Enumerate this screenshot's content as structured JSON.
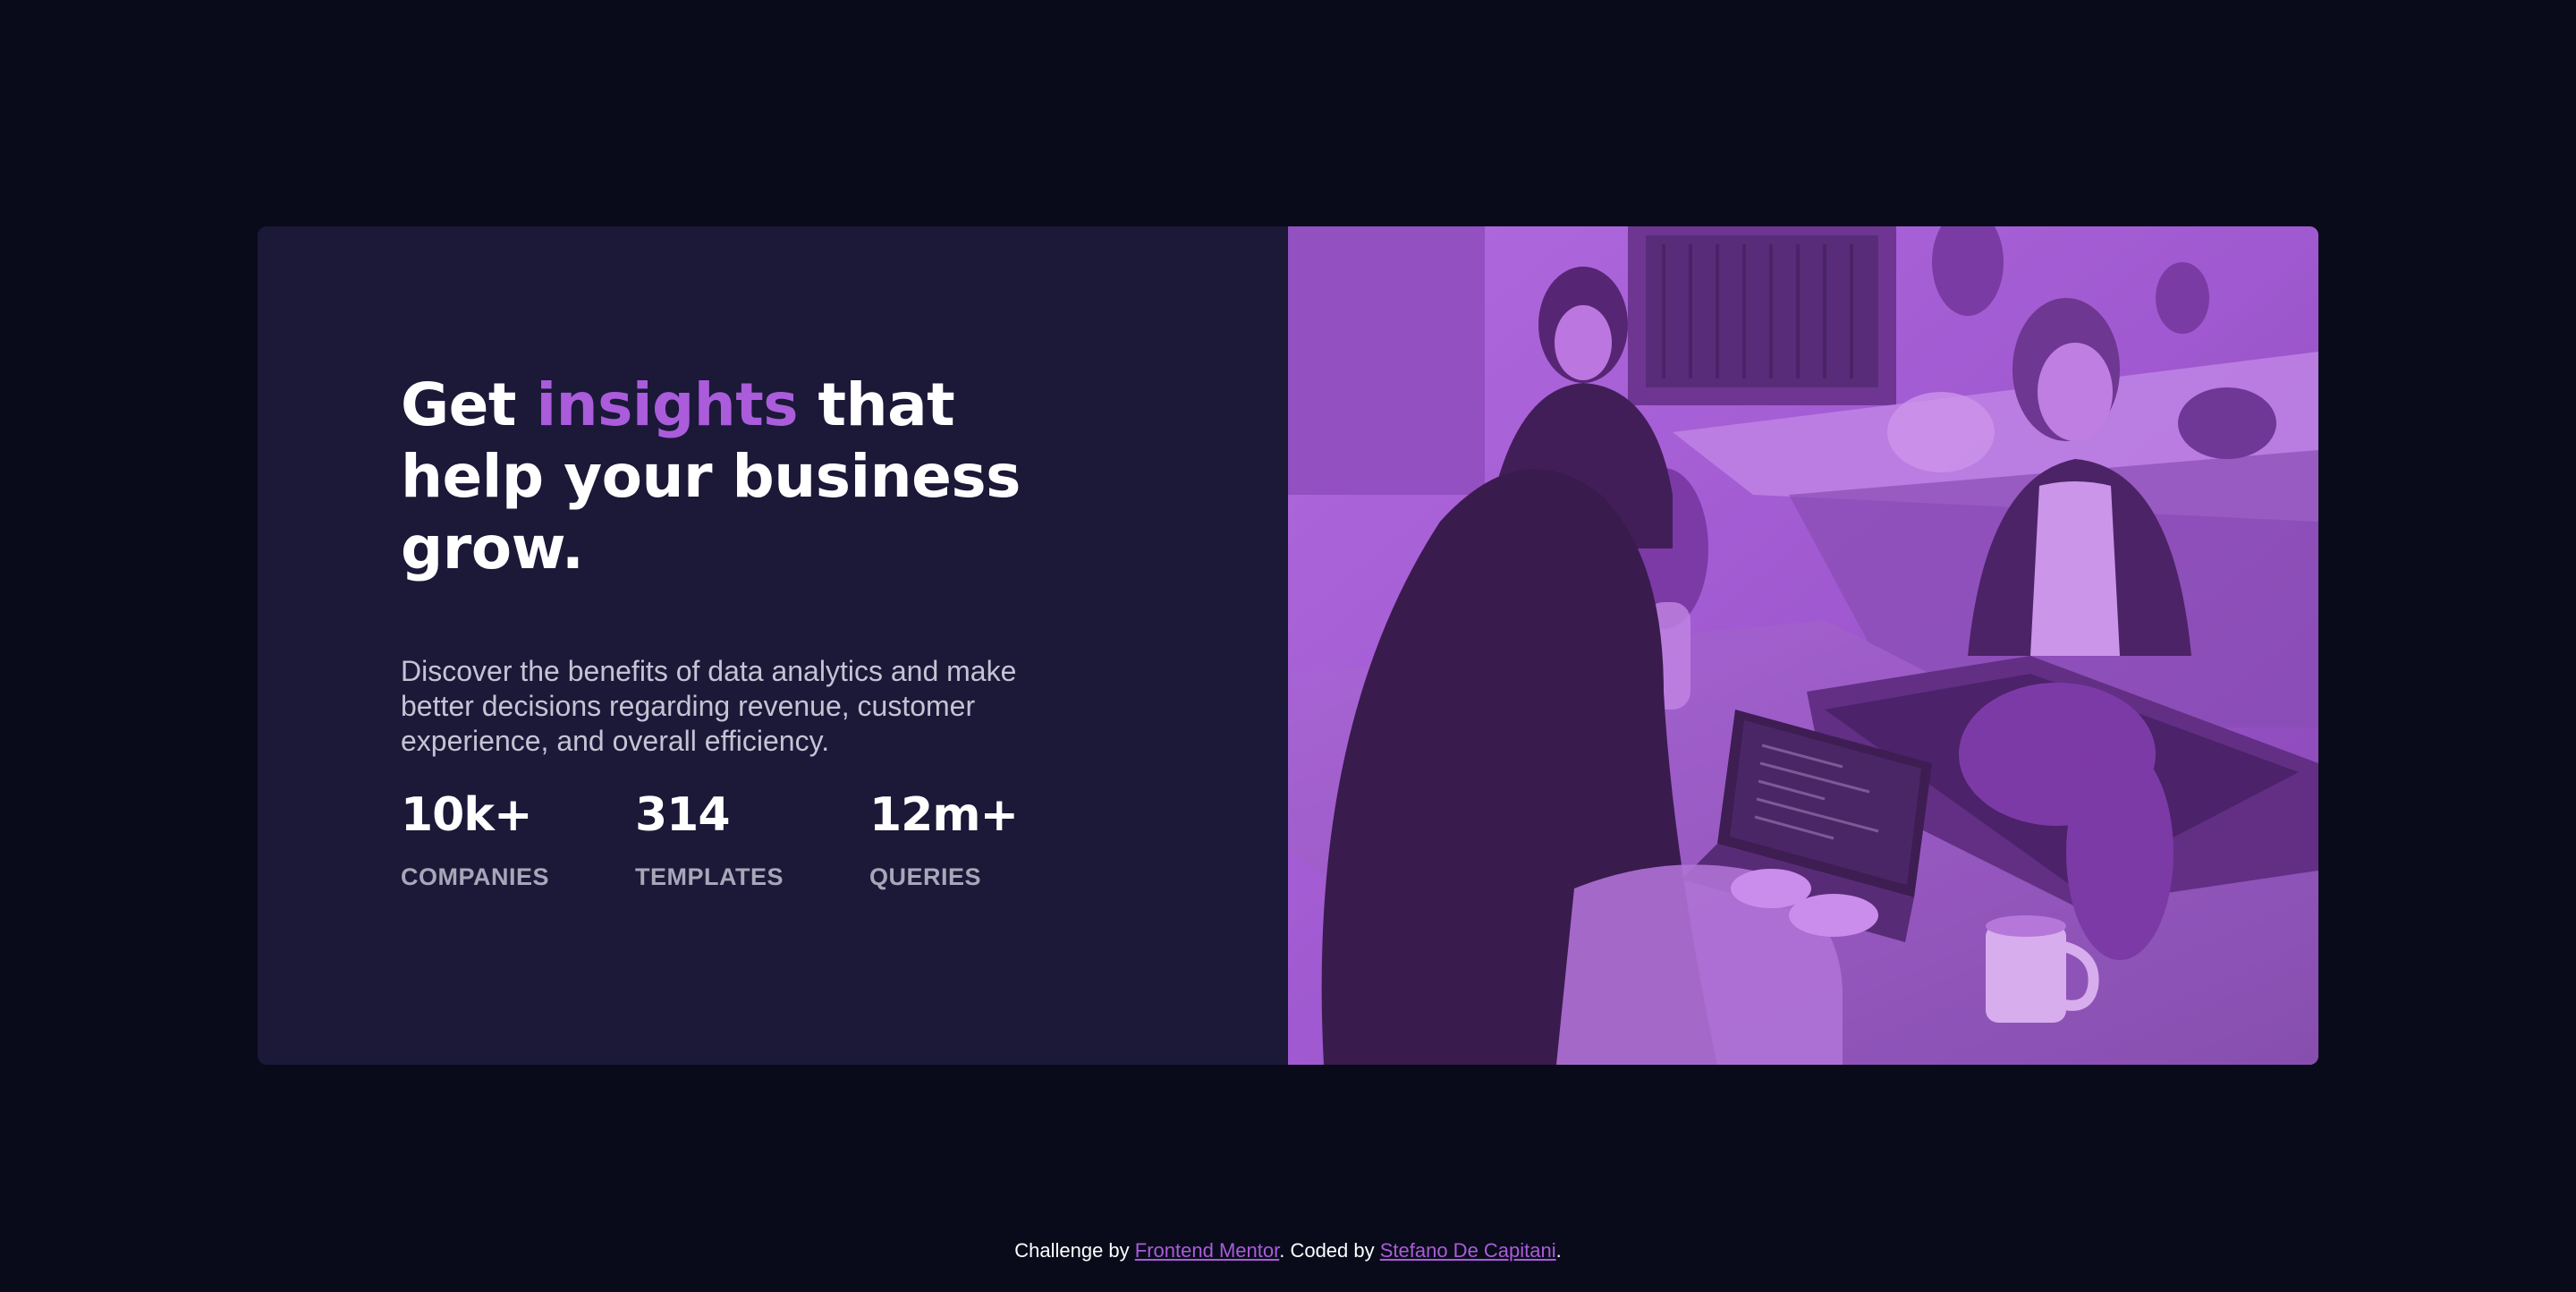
{
  "card": {
    "headline_pre": "Get ",
    "headline_accent": "insights",
    "headline_post": " that help your business grow.",
    "description": "Discover the benefits of data analytics and make better decisions regarding revenue, customer experience, and overall efficiency.",
    "stats": [
      {
        "value": "10k+",
        "label": "COMPANIES"
      },
      {
        "value": "314",
        "label": "TEMPLATES"
      },
      {
        "value": "12m+",
        "label": "QUERIES"
      }
    ]
  },
  "footer": {
    "prefix": "Challenge by ",
    "link1": "Frontend Mentor",
    "middle": ". Coded by ",
    "link2": "Stefano De Capitani",
    "suffix": "."
  },
  "colors": {
    "page_bg": "#090b1a",
    "card_bg": "#1b1838",
    "accent": "#aa5cdb",
    "image_tint": "#9c5ad0"
  }
}
